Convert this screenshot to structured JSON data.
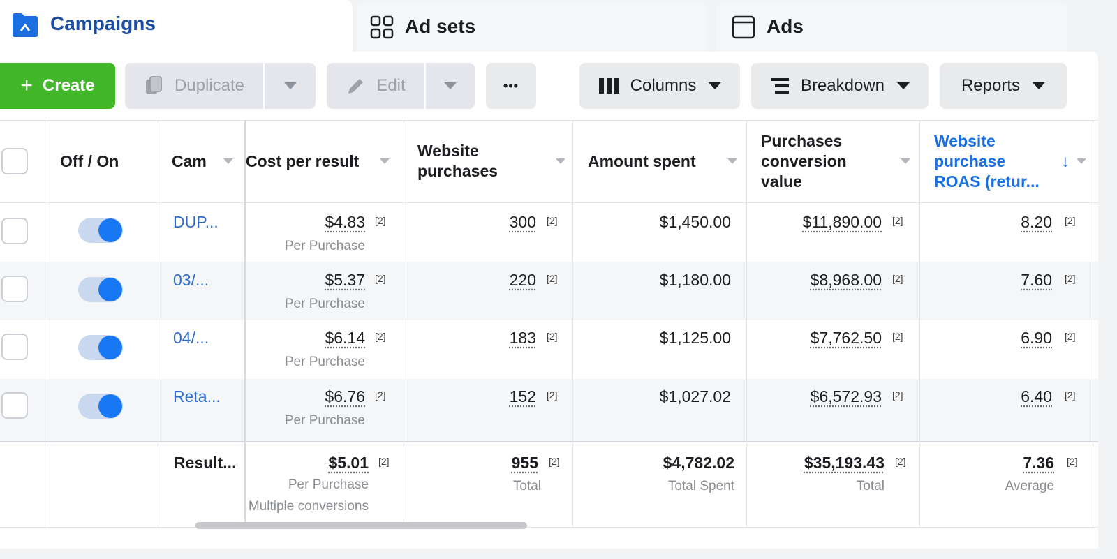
{
  "tabs": [
    {
      "label": "Campaigns",
      "icon": "folder-icon"
    },
    {
      "label": "Ad sets",
      "icon": "grid-icon"
    },
    {
      "label": "Ads",
      "icon": "window-icon"
    }
  ],
  "toolbar": {
    "create": "Create",
    "duplicate": "Duplicate",
    "edit": "Edit",
    "more": "•••",
    "columns": "Columns",
    "breakdown": "Breakdown",
    "reports": "Reports"
  },
  "headers": {
    "toggle": "Off / On",
    "campaign": "Cam",
    "cost": "Cost per result",
    "purchases_1": "Website",
    "purchases_2": "purchases",
    "spent": "Amount spent",
    "conv_1": "Purchases",
    "conv_2": "conversion",
    "conv_3": "value",
    "roas_1": "Website",
    "roas_2": "purchase",
    "roas_3": "ROAS (retur..."
  },
  "note": "[2]",
  "rows": [
    {
      "name": "DUP...",
      "cost": "$4.83",
      "cost_sub": "Per Purchase",
      "purchases": "300",
      "spent": "$1,450.00",
      "conv": "$11,890.00",
      "roas": "8.20"
    },
    {
      "name": "03/...",
      "cost": "$5.37",
      "cost_sub": "Per Purchase",
      "purchases": "220",
      "spent": "$1,180.00",
      "conv": "$8,968.00",
      "roas": "7.60"
    },
    {
      "name": "04/...",
      "cost": "$6.14",
      "cost_sub": "Per Purchase",
      "purchases": "183",
      "spent": "$1,125.00",
      "conv": "$7,762.50",
      "roas": "6.90"
    },
    {
      "name": "Reta...",
      "cost": "$6.76",
      "cost_sub": "Per Purchase",
      "purchases": "152",
      "spent": "$1,027.02",
      "conv": "$6,572.93",
      "roas": "6.40"
    }
  ],
  "totals": {
    "label": "Result...",
    "cost": "$5.01",
    "cost_sub": "Per Purchase",
    "cost_sub2": "Multiple conversions",
    "purchases": "955",
    "purchases_sub": "Total",
    "spent": "$4,782.02",
    "spent_sub": "Total Spent",
    "conv": "$35,193.43",
    "conv_sub": "Total",
    "roas": "7.36",
    "roas_sub": "Average"
  },
  "colors": {
    "accent": "#1877f2",
    "create": "#42b72a",
    "link": "#2f6dce"
  }
}
